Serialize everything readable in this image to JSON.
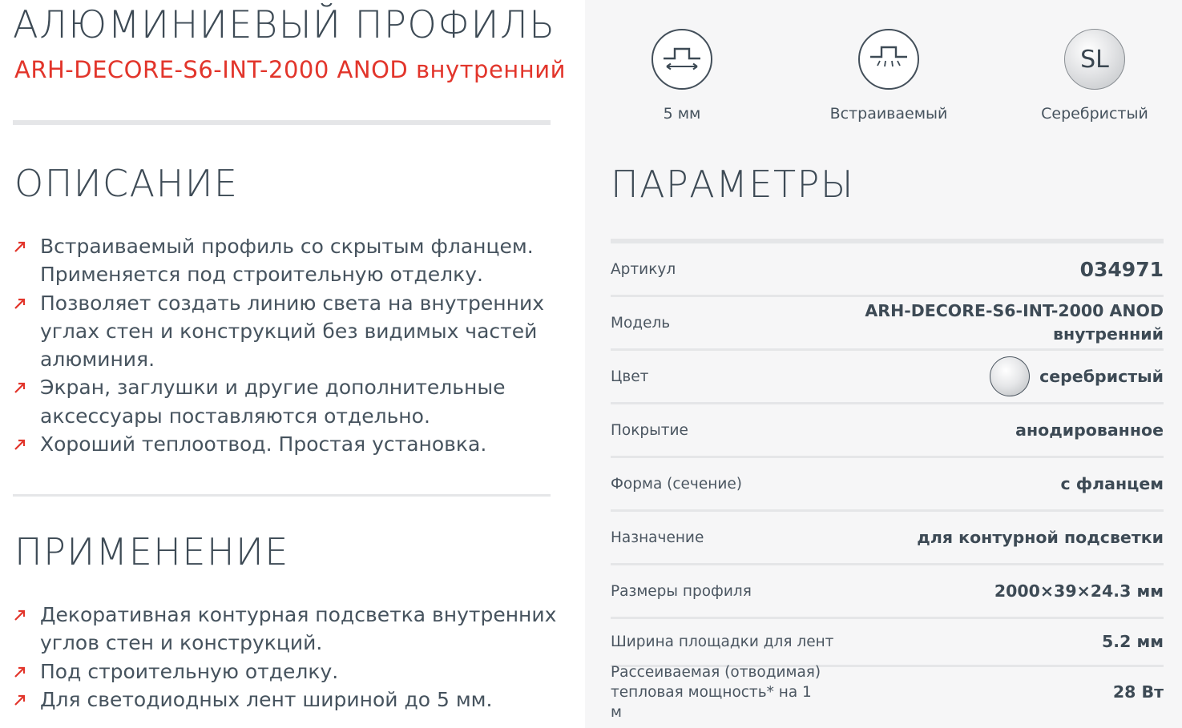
{
  "product": {
    "title": "АЛЮМИНИЕВЫЙ ПРОФИЛЬ",
    "subtitle": "ARH-DECORE-S6-INT-2000 ANOD внутренний"
  },
  "description": {
    "title": "ОПИСАНИЕ",
    "items": [
      "Встраиваемый профиль со скрытым фланцем. Применяется под строительную отделку.",
      "Позволяет создать линию света на внутренних углах стен и конструкций без видимых частей алюминия.",
      "Экран, заглушки и другие дополнительные аксессуары поставляются отдельно.",
      "Хороший теплоотвод. Простая установка."
    ]
  },
  "application": {
    "title": "ПРИМЕНЕНИЕ",
    "items": [
      "Декоративная контурная подсветка внутренних углов стен и конструкций.",
      "Под строительную отделку.",
      "Для светодиодных лент шириной до 5 мм."
    ]
  },
  "badges": [
    {
      "icon": "tape-width-icon",
      "label": "5 мм"
    },
    {
      "icon": "built-in-icon",
      "label": "Встраиваемый"
    },
    {
      "icon": "silver-color-icon",
      "text": "SL",
      "label": "Серебристый"
    }
  ],
  "params": {
    "title": "ПАРАМЕТРЫ",
    "rows": [
      {
        "key": "Артикул",
        "value": "034971"
      },
      {
        "key": "Модель",
        "value": "ARH-DECORE-S6-INT-2000 ANOD внутренний"
      },
      {
        "key": "Цвет",
        "value": "серебристый"
      },
      {
        "key": "Покрытие",
        "value": "анодированное"
      },
      {
        "key": "Форма (сечение)",
        "value": "с фланцем"
      },
      {
        "key": "Назначение",
        "value": "для контурной подсветки"
      },
      {
        "key": "Размеры профиля",
        "value": "2000×39×24.3 мм"
      },
      {
        "key": "Ширина площадки для лент",
        "value": "5.2 мм"
      },
      {
        "key": "Рассеиваемая (отводимая) тепловая мощность* на 1 м",
        "value": "28 Вт"
      }
    ]
  },
  "colors": {
    "accent": "#e2352b",
    "text": "#3d4a55",
    "panel": "#f6f6f7"
  }
}
